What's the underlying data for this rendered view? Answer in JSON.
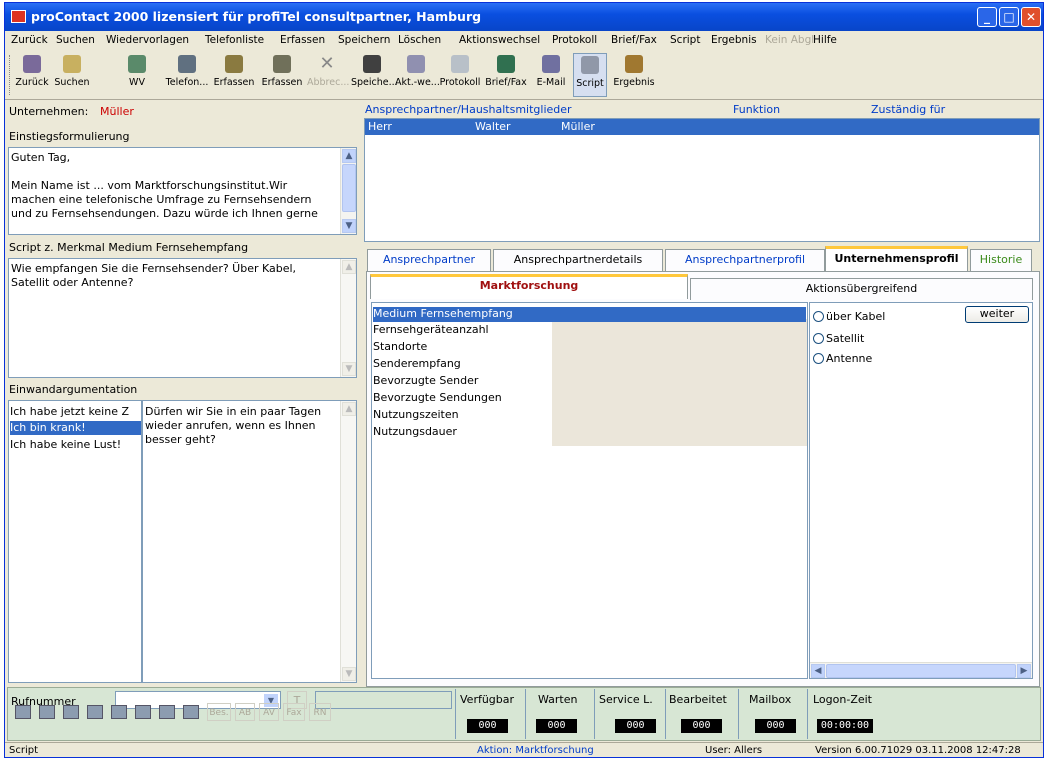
{
  "window": {
    "title": "proContact 2000 lizensiert für profiTel consultpartner, Hamburg"
  },
  "menu": [
    "Zurück",
    "Suchen",
    "Wiedervorlagen",
    "Telefonliste",
    "Erfassen",
    "Speichern",
    "Löschen",
    "Aktionswechsel",
    "Protokoll",
    "Brief/Fax",
    "Script",
    "Ergebnis",
    "Kein Abgl",
    "Hilfe"
  ],
  "toolbar": [
    "Zurück",
    "Suchen",
    "WV",
    "Telefon...",
    "Erfassen",
    "Erfassen",
    "Abbrec...",
    "Speiche...",
    "Akt.-we...",
    "Protokoll",
    "Brief/Fax",
    "E-Mail",
    "Script",
    "Ergebnis"
  ],
  "company": {
    "label": "Unternehmen:",
    "value": "Müller"
  },
  "intro": {
    "title": "Einstiegsformulierung",
    "lines": [
      "Guten Tag,",
      "",
      "Mein Name ist ... vom Marktforschungsinstitut.Wir",
      "machen eine telefonische Umfrage zu Fernsehsendern",
      "und zu Fernsehsendungen. Dazu würde ich Ihnen gerne"
    ]
  },
  "script": {
    "title": "Script z. Merkmal  Medium Fernsehempfang",
    "lines": [
      "Wie empfangen Sie die Fernsehsender? Über Kabel,",
      "Satellit oder Antenne?"
    ]
  },
  "objection": {
    "title": "Einwandargumentation",
    "items": [
      "Ich habe jetzt keine Z",
      "Ich bin krank!",
      "Ich habe keine Lust!"
    ],
    "response_lines": [
      "Dürfen wir Sie in ein paar Tagen",
      "wieder anrufen, wenn es Ihnen",
      "besser geht?"
    ]
  },
  "contacts": {
    "headers": [
      "Ansprechpartner/Haushaltsmitglieder",
      "Funktion",
      "Zuständig für"
    ],
    "row": {
      "salutation": "Herr",
      "first": "Walter",
      "last": "Müller"
    }
  },
  "tabs": [
    "Ansprechpartner",
    "Ansprechpartnerdetails",
    "Ansprechpartnerprofil",
    "Unternehmensprofil",
    "Historie"
  ],
  "subtabs": [
    "Marktforschung",
    "Aktionsübergreifend"
  ],
  "features": [
    "Medium Fernsehempfang",
    "Fernsehgeräteanzahl",
    "Standorte",
    "Senderempfang",
    "Bevorzugte Sender",
    "Bevorzugte Sendungen",
    "Nutzungszeiten",
    "Nutzungsdauer"
  ],
  "options": {
    "items": [
      "über Kabel",
      "Satellit",
      "Antenne"
    ],
    "next_label": "weiter"
  },
  "phone": {
    "label": "Rufnummer",
    "t_label": "T",
    "buttons": [
      "Bes.",
      "AB",
      "AV",
      "Fax",
      "RN"
    ]
  },
  "counters": [
    {
      "label": "Verfügbar",
      "value": "000"
    },
    {
      "label": "Warten",
      "value": "000"
    },
    {
      "label": "Service L.",
      "value": "000"
    },
    {
      "label": "Bearbeitet",
      "value": "000"
    },
    {
      "label": "Mailbox",
      "value": "000"
    },
    {
      "label": "Logon-Zeit",
      "value": "00:00:00"
    }
  ],
  "status": {
    "left": "Script",
    "action": "Aktion: Marktforschung",
    "user": "User: Allers",
    "version": "Version 6.00.71029   03.11.2008  12:47:28"
  }
}
